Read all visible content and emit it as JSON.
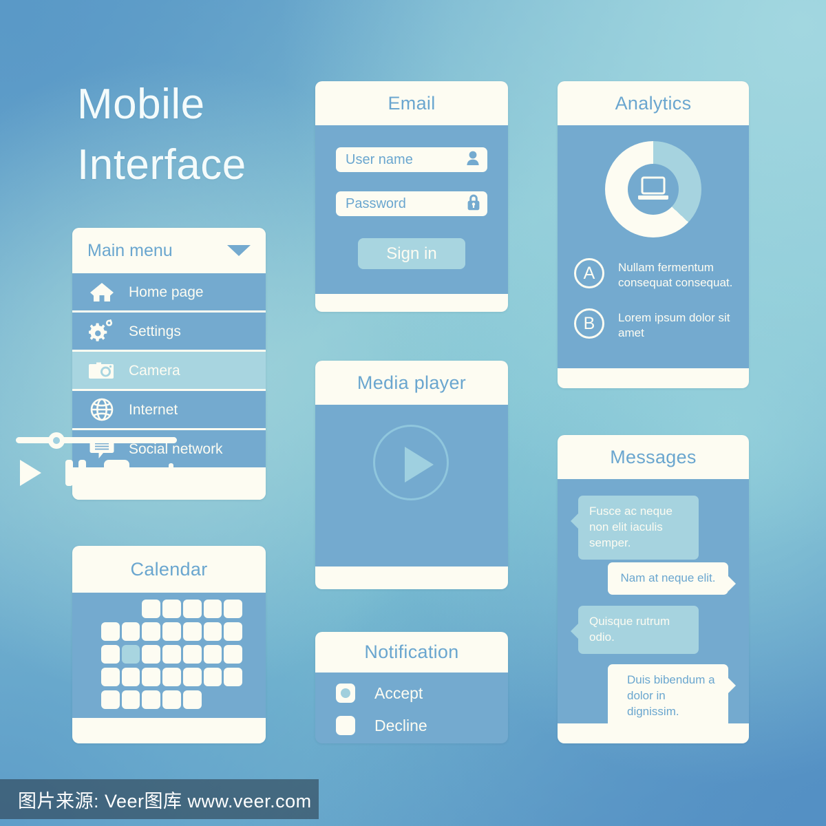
{
  "title": {
    "line1": "Mobile",
    "line2": "Interface"
  },
  "theme": {
    "panel_blue": "#74aacf",
    "cream": "#fdfcf2",
    "accent_light_blue": "#a8d5e0",
    "text_blue": "#6aa6cf"
  },
  "menu": {
    "header_label": "Main menu",
    "caret_icon": "chevron-down-icon",
    "items": [
      {
        "label": "Home page",
        "icon": "home-icon",
        "selected": false
      },
      {
        "label": "Settings",
        "icon": "gears-icon",
        "selected": false
      },
      {
        "label": "Camera",
        "icon": "camera-icon",
        "selected": true
      },
      {
        "label": "Internet",
        "icon": "globe-icon",
        "selected": false
      },
      {
        "label": "Social network",
        "icon": "chat-bubble-icon",
        "selected": false
      }
    ]
  },
  "calendar": {
    "title": "Calendar",
    "rows": [
      [
        "empty",
        "empty",
        "day",
        "day",
        "day",
        "day",
        "day"
      ],
      [
        "day",
        "day",
        "day",
        "day",
        "day",
        "day",
        "day"
      ],
      [
        "day",
        "selected",
        "day",
        "day",
        "day",
        "day",
        "day"
      ],
      [
        "day",
        "day",
        "day",
        "day",
        "day",
        "day",
        "day"
      ],
      [
        "day",
        "day",
        "day",
        "day",
        "day",
        "empty",
        "empty"
      ]
    ],
    "selected_cell": {
      "row": 3,
      "col": 2
    }
  },
  "email": {
    "title": "Email",
    "username": {
      "placeholder": "User name",
      "value": "",
      "icon": "user-icon"
    },
    "password": {
      "placeholder": "Password",
      "value": "",
      "icon": "lock-icon"
    },
    "submit_label": "Sign in"
  },
  "media": {
    "title": "Media player",
    "play_overlay_icon": "play-circle-icon",
    "seek_position_percent": 25,
    "controls": [
      {
        "name": "play-button",
        "icon": "play-icon"
      },
      {
        "name": "pause-button",
        "icon": "pause-icon"
      },
      {
        "name": "stop-button",
        "icon": "stop-icon"
      },
      {
        "name": "volume-indicator",
        "icon": "volume-bars-icon"
      }
    ],
    "volume_bars": [
      6,
      12,
      19,
      26,
      33
    ]
  },
  "notification": {
    "title": "Notification",
    "options": [
      {
        "label": "Accept",
        "selected": true
      },
      {
        "label": "Decline",
        "selected": false
      }
    ]
  },
  "analytics": {
    "title": "Analytics",
    "center_icon": "laptop-icon",
    "legend": [
      {
        "badge": "A",
        "text": "Nullam fermentum consequat consequat."
      },
      {
        "badge": "B",
        "text": "Lorem ipsum dolor sit amet"
      }
    ],
    "chart_data": {
      "type": "pie",
      "title": "Analytics",
      "categories": [
        "B",
        "A"
      ],
      "values": [
        37,
        63
      ],
      "colors": [
        "#a6d3df",
        "#fdfcf2"
      ],
      "hole_ratio": 0.53,
      "start_angle_deg": 0,
      "legend_position": "below",
      "grid": false
    }
  },
  "messages": {
    "title": "Messages",
    "threads": [
      {
        "side": "left",
        "text": "Fusce ac neque non elit iaculis semper."
      },
      {
        "side": "right",
        "text": "Nam at neque elit."
      },
      {
        "side": "left",
        "text": "Quisque rutrum odio."
      },
      {
        "side": "right",
        "text": "Duis bibendum a dolor in dignissim."
      }
    ]
  },
  "watermark": {
    "text": "图片来源: Veer图库 www.veer.com"
  }
}
